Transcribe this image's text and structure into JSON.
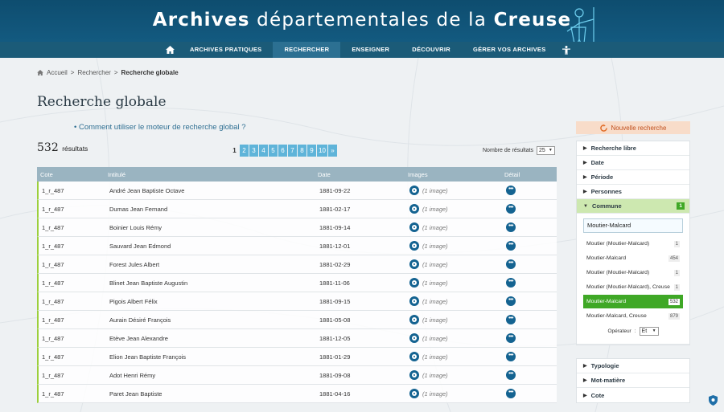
{
  "header": {
    "title_bold1": "Archives",
    "title_mid": " départementales de la ",
    "title_bold2": "Creuse",
    "nav": [
      "ARCHIVES PRATIQUES",
      "RECHERCHER",
      "ENSEIGNER",
      "DÉCOUVRIR",
      "GÉRER VOS ARCHIVES"
    ],
    "nav_active": 1
  },
  "breadcrumb": {
    "home": "Accueil",
    "sep": ">",
    "level1": "Rechercher",
    "current": "Recherche globale"
  },
  "page_title": "Recherche globale",
  "help_link": "Comment utiliser le moteur de recherche global ?",
  "results": {
    "count": "532",
    "label": "résultats"
  },
  "pager": {
    "pages": [
      "1",
      "2",
      "3",
      "4",
      "5",
      "6",
      "7",
      "8",
      "9",
      "10"
    ],
    "current": "1",
    "next": "»"
  },
  "per_page": {
    "label": "Nombre de résultats",
    "value": "25"
  },
  "table": {
    "headers": [
      "Cote",
      "Intitulé",
      "Date",
      "Images",
      "Détail"
    ],
    "image_label": "(1 image)",
    "rows": [
      {
        "cote": "1_r_487",
        "intitule": "André Jean Baptiste Octave",
        "date": "1881-09-22"
      },
      {
        "cote": "1_r_487",
        "intitule": "Dumas Jean Fernand",
        "date": "1881-02-17"
      },
      {
        "cote": "1_r_487",
        "intitule": "Boinier Louis Rémy",
        "date": "1881-09-14"
      },
      {
        "cote": "1_r_487",
        "intitule": "Sauvard Jean Edmond",
        "date": "1881-12-01"
      },
      {
        "cote": "1_r_487",
        "intitule": "Forest Jules Albert",
        "date": "1881-02-29"
      },
      {
        "cote": "1_r_487",
        "intitule": "Blinet Jean Baptiste Augustin",
        "date": "1881-11-06"
      },
      {
        "cote": "1_r_487",
        "intitule": "Pigois Albert Félix",
        "date": "1881-09-15"
      },
      {
        "cote": "1_r_487",
        "intitule": "Aurain Désiré François",
        "date": "1881-05-08"
      },
      {
        "cote": "1_r_487",
        "intitule": "Etève Jean Alexandre",
        "date": "1881-12-05"
      },
      {
        "cote": "1_r_487",
        "intitule": "Elion Jean Baptiste François",
        "date": "1881-01-29"
      },
      {
        "cote": "1_r_487",
        "intitule": "Adot Henri Rémy",
        "date": "1881-09-08"
      },
      {
        "cote": "1_r_487",
        "intitule": "Paret Jean Baptiste",
        "date": "1881-04-16"
      }
    ]
  },
  "sidebar": {
    "new_search": "Nouvelle recherche",
    "facets_top": [
      "Recherche libre",
      "Date",
      "Période",
      "Personnes"
    ],
    "commune": {
      "label": "Commune",
      "badge": "1",
      "input_value": "Moutier-Malcard",
      "options": [
        {
          "label": "Moutier (Moutier-Malcard)",
          "count": "1",
          "selected": false
        },
        {
          "label": "Moutier-Malcard",
          "count": "454",
          "selected": false
        },
        {
          "label": "Moutier (Moutier-Malcard)",
          "count": "1",
          "selected": false
        },
        {
          "label": "Moutier (Moutier-Malcard), Creuse",
          "count": "1",
          "selected": false
        },
        {
          "label": "Moutier-Malcard",
          "count": "532",
          "selected": true
        },
        {
          "label": "Moutier-Malcard, Creuse",
          "count": "879",
          "selected": false
        }
      ],
      "operator_label": "Opérateur",
      "operator_value": "Et"
    },
    "facets_bottom": [
      "Typologie",
      "Mot-matière",
      "Cote"
    ]
  },
  "colors": {
    "header": "#0e4d6f",
    "accent": "#146391",
    "green": "#3fa826",
    "orange": "#c1501e"
  }
}
